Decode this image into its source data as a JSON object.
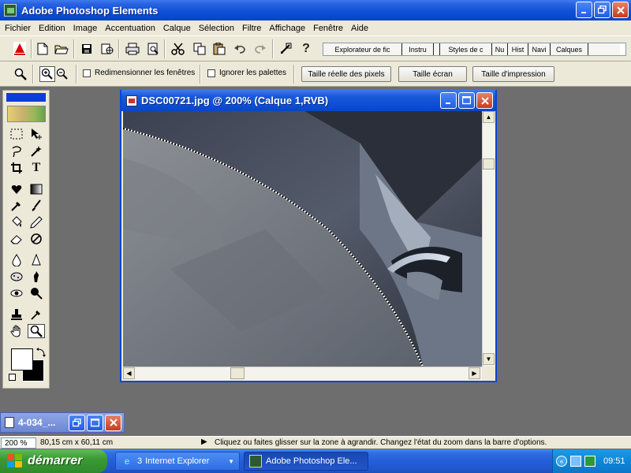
{
  "app": {
    "title": "Adobe Photoshop Elements"
  },
  "menu": {
    "items": [
      "Fichier",
      "Edition",
      "Image",
      "Accentuation",
      "Calque",
      "Sélection",
      "Filtre",
      "Affichage",
      "Fenêtre",
      "Aide"
    ]
  },
  "toolbar": {
    "palette_tabs": [
      "Explorateur de fic",
      "Instru",
      "Styles de c",
      "Nu",
      "Hist",
      "Navi",
      "Calques"
    ],
    "option_checkboxes": [
      "Redimensionner les fenêtres",
      "Ignorer les palettes"
    ],
    "option_buttons": [
      "Taille réelle des pixels",
      "Taille écran",
      "Taille d'impression"
    ]
  },
  "document": {
    "title": "DSC00721.jpg @ 200% (Calque  1,RVB)"
  },
  "minimized_doc": {
    "title": "4-034_..."
  },
  "statusbar": {
    "zoom": "200 %",
    "size": "80,15 cm x 60,11 cm",
    "hint": "Cliquez ou faites glisser sur la zone à agrandir. Changez l'état du zoom dans la barre d'options."
  },
  "taskbar": {
    "start_label": "démarrer",
    "tasks": [
      {
        "count": "3",
        "label": "Internet Explorer"
      },
      {
        "label": "Adobe Photoshop Ele..."
      }
    ],
    "clock": "09:51"
  },
  "colors": {
    "accent": "#0a45d6",
    "foreground_color": "#ffffff",
    "background_color": "#000000"
  }
}
